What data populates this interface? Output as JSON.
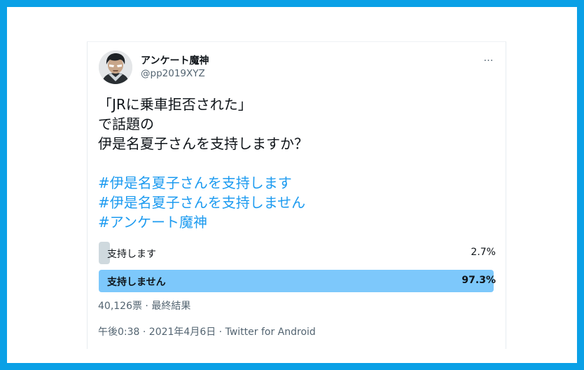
{
  "tweet": {
    "display_name": "アンケート魔神",
    "handle": "@pp2019XYZ",
    "more_icon": "…",
    "lines": [
      "「JRに乗車拒否された」",
      "で話題の",
      "伊是名夏子さんを支持しますか？"
    ],
    "hashtags": [
      "#伊是名夏子さんを支持します",
      "#伊是名夏子さんを支持しません",
      "#アンケート魔神"
    ]
  },
  "poll": {
    "options": [
      {
        "label": "支持します",
        "percent_text": "2.7%",
        "percent": 2.7,
        "winner": false
      },
      {
        "label": "支持しません",
        "percent_text": "97.3%",
        "percent": 97.3,
        "winner": true
      }
    ],
    "votes_summary": "40,126票 · 最終結果"
  },
  "timestamp": "午後0:38 · 2021年4月6日 · Twitter for Android",
  "colors": {
    "frame": "#0aa0e6",
    "hashtag": "#1d9bf0",
    "winner_bar": "#7dc8fb",
    "loser_bar": "#cfd9de"
  },
  "icons": {
    "avatar": "profile-avatar",
    "more": "more-options-icon"
  }
}
